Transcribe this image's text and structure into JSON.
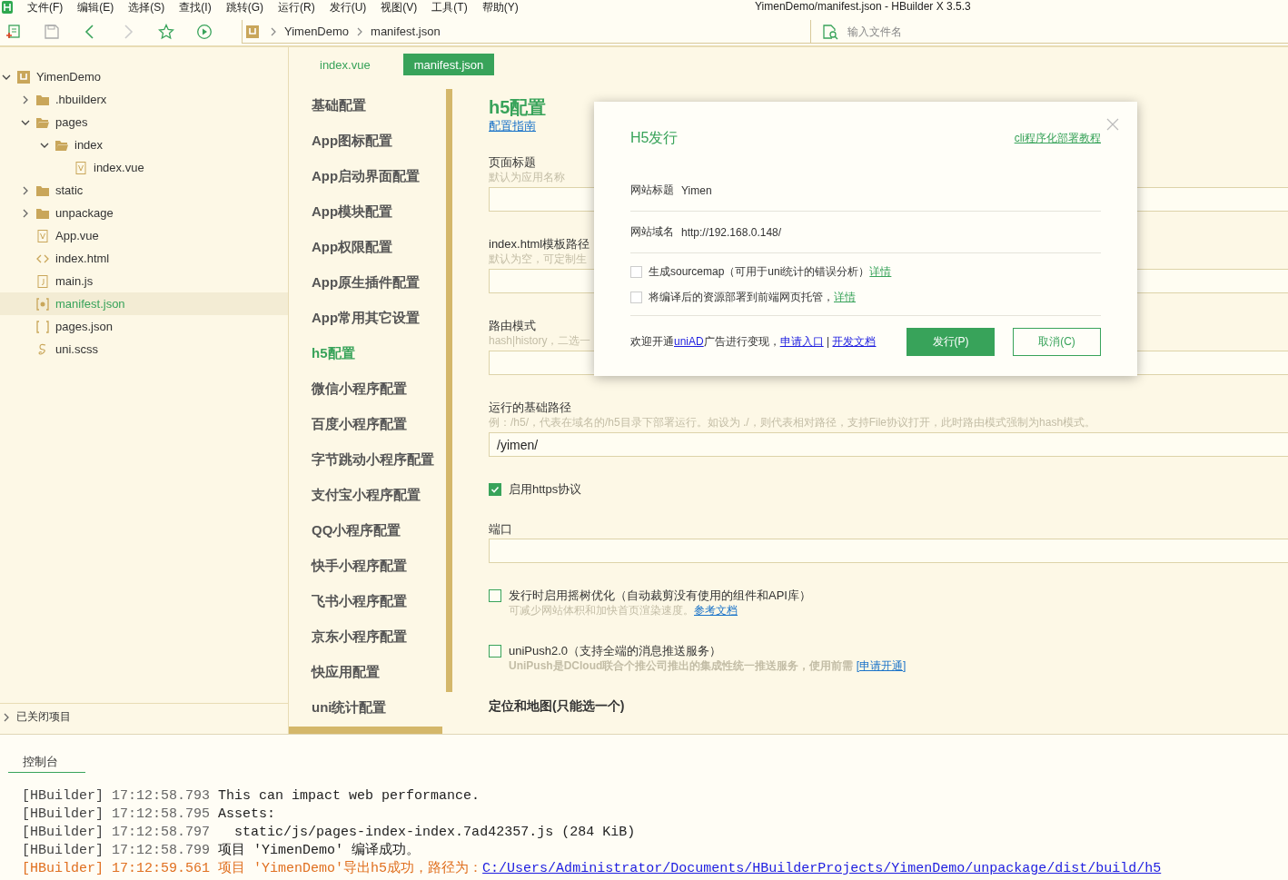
{
  "menu_bar": {
    "items": [
      "文件(F)",
      "编辑(E)",
      "选择(S)",
      "查找(I)",
      "跳转(G)",
      "运行(R)",
      "发行(U)",
      "视图(V)",
      "工具(T)",
      "帮助(Y)"
    ],
    "title": "YimenDemo/manifest.json - HBuilder X 3.5.3"
  },
  "toolbar": {
    "breadcrumb": [
      "YimenDemo",
      "manifest.json"
    ],
    "search": {
      "placeholder": "输入文件名"
    }
  },
  "project_tree": {
    "items": [
      {
        "label": "YimenDemo",
        "kind": "project",
        "expanded": true,
        "selected": false,
        "children": [
          {
            "label": ".hbuilderx",
            "kind": "folder",
            "expanded": false,
            "selected": false
          },
          {
            "label": "pages",
            "kind": "folder",
            "expanded": true,
            "selected": false,
            "children": [
              {
                "label": "index",
                "kind": "folder",
                "expanded": true,
                "selected": false,
                "children": [
                  {
                    "label": "index.vue",
                    "kind": "vue",
                    "selected": false
                  }
                ]
              }
            ]
          },
          {
            "label": "static",
            "kind": "folder",
            "expanded": false,
            "selected": false
          },
          {
            "label": "unpackage",
            "kind": "folder",
            "expanded": false,
            "selected": false
          },
          {
            "label": "App.vue",
            "kind": "vue",
            "selected": false
          },
          {
            "label": "index.html",
            "kind": "html",
            "selected": false
          },
          {
            "label": "main.js",
            "kind": "js",
            "selected": false
          },
          {
            "label": "manifest.json",
            "kind": "config",
            "selected": true
          },
          {
            "label": "pages.json",
            "kind": "json",
            "selected": false
          },
          {
            "label": "uni.scss",
            "kind": "scss",
            "selected": false
          }
        ]
      }
    ],
    "closed_projects": "已关闭项目"
  },
  "editor_tabs": [
    {
      "label": "index.vue",
      "selected": false
    },
    {
      "label": "manifest.json",
      "selected": true
    }
  ],
  "settings_nav": [
    {
      "label": "基础配置",
      "selected": false
    },
    {
      "label": "App图标配置",
      "selected": false
    },
    {
      "label": "App启动界面配置",
      "selected": false
    },
    {
      "label": "App模块配置",
      "selected": false
    },
    {
      "label": "App权限配置",
      "selected": false
    },
    {
      "label": "App原生插件配置",
      "selected": false
    },
    {
      "label": "App常用其它设置",
      "selected": false
    },
    {
      "label": "h5配置",
      "selected": true
    },
    {
      "label": "微信小程序配置",
      "selected": false
    },
    {
      "label": "百度小程序配置",
      "selected": false
    },
    {
      "label": "字节跳动小程序配置",
      "selected": false
    },
    {
      "label": "支付宝小程序配置",
      "selected": false
    },
    {
      "label": "QQ小程序配置",
      "selected": false
    },
    {
      "label": "快手小程序配置",
      "selected": false
    },
    {
      "label": "飞书小程序配置",
      "selected": false
    },
    {
      "label": "京东小程序配置",
      "selected": false
    },
    {
      "label": "快应用配置",
      "selected": false
    },
    {
      "label": "uni统计配置",
      "selected": false
    }
  ],
  "form": {
    "title": "h5配置",
    "guide_link": "配置指南",
    "fields": [
      {
        "kind": "input",
        "label": "页面标题",
        "hint": "默认为应用名称"
      },
      {
        "kind": "input",
        "label": "index.html模板路径",
        "hint": "默认为空，可定制生"
      },
      {
        "kind": "input",
        "label": "路由模式",
        "hint": "hash|history，二选一"
      },
      {
        "kind": "input",
        "label": "运行的基础路径",
        "hint": "例：/h5/，代表在域名的/h5目录下部署运行。如设为 ./，则代表相对路径，支持File协议打开，此时路由模式强制为hash模式。",
        "value": "/yimen/"
      },
      {
        "kind": "checkbox",
        "label": "启用https协议",
        "checked": true
      },
      {
        "kind": "input",
        "label": "端口"
      },
      {
        "kind": "checkbox",
        "label": "发行时启用摇树优化（自动裁剪没有使用的组件和API库）",
        "checked": false,
        "hint": "可减少网站体积和加快首页渲染速度。",
        "link": "参考文档",
        "hint_bold": false
      },
      {
        "kind": "checkbox",
        "label": "uniPush2.0（支持全端的消息推送服务）",
        "checked": false,
        "hint": "UniPush是DCloud联合个推公司推出的集成性统一推送服务，使用前需 ",
        "link": "[申请开通]",
        "hint_bold": true
      },
      {
        "kind": "section",
        "label": "定位和地图(只能选一个)"
      }
    ]
  },
  "dialog": {
    "title": "H5发行",
    "tutorial_link": "cli程序化部署教程",
    "fields": [
      {
        "label": "网站标题",
        "value": "Yimen"
      },
      {
        "label": "网站域名",
        "value": "http://192.168.0.148/"
      }
    ],
    "options": [
      {
        "label": "生成sourcemap（可用于uni统计的错误分析）",
        "link": "详情",
        "checked": false
      },
      {
        "label": "将编译后的资源部署到前端网页托管，",
        "link": "详情",
        "checked": false
      }
    ],
    "promo": [
      {
        "kind": "text",
        "text": "欢迎开通"
      },
      {
        "kind": "link",
        "text": "uniAD"
      },
      {
        "kind": "text",
        "text": "广告进行变现，"
      },
      {
        "kind": "link",
        "text": "申请入口"
      },
      {
        "kind": "text",
        "text": " | "
      },
      {
        "kind": "link",
        "text": "开发文档"
      }
    ],
    "buttons": [
      {
        "label": "发行(P)",
        "kind": "primary"
      },
      {
        "label": "取消(C)",
        "kind": "secondary"
      }
    ]
  },
  "console": {
    "tab": "控制台",
    "lines": [
      {
        "source": "[HBuilder]",
        "time": "17:12:58.793",
        "message": "This can impact web performance.",
        "kind": "info"
      },
      {
        "source": "[HBuilder]",
        "time": "17:12:58.795",
        "message": "Assets:",
        "kind": "info"
      },
      {
        "source": "[HBuilder]",
        "time": "17:12:58.797",
        "message": "  static/js/pages-index-index.7ad42357.js (284 KiB)",
        "kind": "info"
      },
      {
        "source": "[HBuilder]",
        "time": "17:12:58.799",
        "message": "项目 'YimenDemo' 编译成功。",
        "kind": "info"
      },
      {
        "source": "[HBuilder]",
        "time": "17:12:59.561",
        "message": "项目 'YimenDemo'导出h5成功，路径为：",
        "link": "C:/Users/Administrator/Documents/HBuilderProjects/YimenDemo/unpackage/dist/build/h5",
        "kind": "success"
      }
    ]
  }
}
